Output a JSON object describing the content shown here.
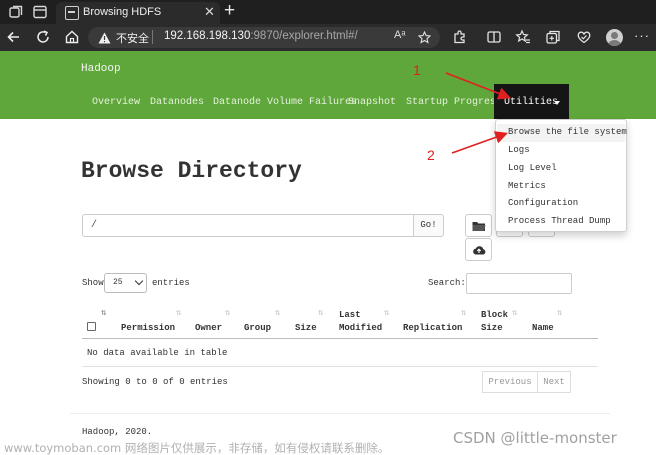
{
  "browser": {
    "tab_title": "Browsing HDFS",
    "tab_close": "✕",
    "new_tab": "+",
    "security_label": "不安全",
    "url_host": "192.168.198.130",
    "url_rest": ":9870/explorer.html#/",
    "read_aloud": "Aᵃ",
    "menu": "···"
  },
  "navbar": {
    "brand": "Hadoop",
    "items": [
      "Overview",
      "Datanodes",
      "Datanode Volume Failures",
      "Snapshot",
      "Startup Progress"
    ],
    "active": "Utilities"
  },
  "dropdown": {
    "items": [
      "Browse the file system",
      "Logs",
      "Log Level",
      "Metrics",
      "Configuration",
      "Process Thread Dump"
    ]
  },
  "annotations": {
    "first": "1",
    "second": "2"
  },
  "page": {
    "title": "Browse Directory",
    "path_value": "/",
    "go_label": "Go!",
    "show_label": "Show",
    "entries_value": "25",
    "entries_label": "entries",
    "search_label": "Search:",
    "columns": [
      "Permission",
      "Owner",
      "Group",
      "Size",
      "Last",
      "Modified",
      "Replication",
      "Block",
      "Size",
      "Name"
    ],
    "empty_message": "No data available in table",
    "info": "Showing 0 to 0 of 0 entries",
    "previous_label": "Previous",
    "next_label": "Next",
    "footer": "Hadoop, 2020."
  },
  "watermark": {
    "left": "www.toymoban.com 网络图片仅供展示，非存储，如有侵权请联系删除。",
    "right": "CSDN @little-monster"
  },
  "colors": {
    "navbar": "#5fa73a",
    "active_nav": "#151515",
    "annotation": "#e02020",
    "chrome_dark": "#1f1f1f"
  },
  "icons": [
    "workspaces-icon",
    "tab-actions-icon",
    "favicon-icon",
    "back-icon",
    "refresh-icon",
    "home-icon",
    "warning-icon",
    "favorite-icon",
    "extensions-icon",
    "split-screen-icon",
    "favorites-icon",
    "collections-icon",
    "browser-essentials-icon",
    "profile-icon",
    "folder-icon",
    "upload-icon"
  ]
}
